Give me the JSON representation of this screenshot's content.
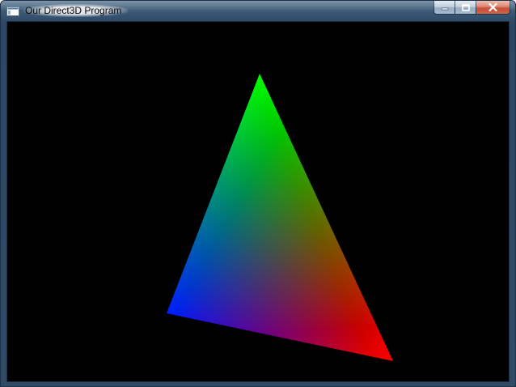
{
  "window": {
    "title": "Our Direct3D Program",
    "icon": "app-window-icon",
    "frame_color": "#2f4b66",
    "client_background": "#000000"
  },
  "caption_buttons": {
    "minimize_icon": "minimize-icon",
    "maximize_icon": "maximize-icon",
    "close_icon": "close-icon",
    "close_color": "#c94a31"
  },
  "scene": {
    "vertex_colors": {
      "top": "#00ff00",
      "bottom_left": "#0000ff",
      "bottom_right": "#ff0000"
    }
  }
}
